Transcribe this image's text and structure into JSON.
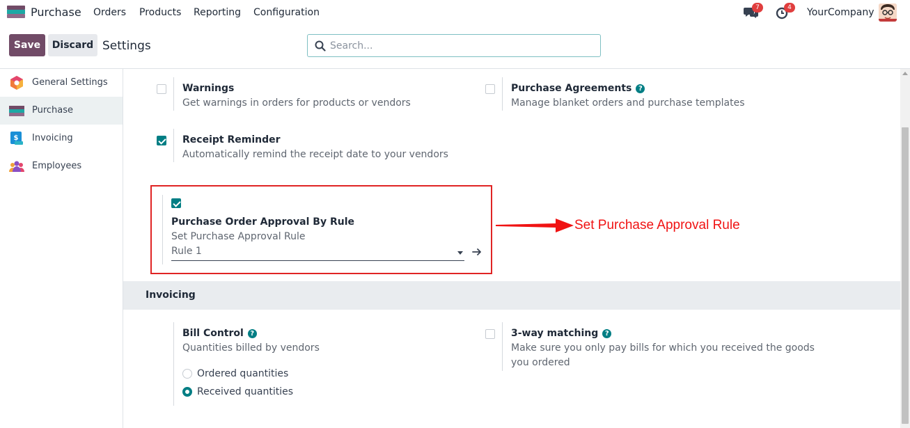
{
  "navbar": {
    "app_name": "Purchase",
    "menu": [
      "Orders",
      "Products",
      "Reporting",
      "Configuration"
    ],
    "messages_count": "7",
    "activities_count": "4",
    "company": "YourCompany"
  },
  "control_panel": {
    "save_label": "Save",
    "discard_label": "Discard",
    "breadcrumb": "Settings",
    "search_placeholder": "Search..."
  },
  "sidebar": {
    "items": [
      {
        "label": "General Settings",
        "icon": "general-settings-icon",
        "active": false
      },
      {
        "label": "Purchase",
        "icon": "purchase-app-icon",
        "active": true
      },
      {
        "label": "Invoicing",
        "icon": "invoicing-app-icon",
        "active": false
      },
      {
        "label": "Employees",
        "icon": "employees-app-icon",
        "active": false
      }
    ]
  },
  "settings": {
    "warnings": {
      "title": "Warnings",
      "desc": "Get warnings in orders for products or vendors",
      "checked": false
    },
    "purchase_agreements": {
      "title": "Purchase Agreements",
      "desc": "Manage blanket orders and purchase templates",
      "checked": false,
      "help": "?"
    },
    "receipt_reminder": {
      "title": "Receipt Reminder",
      "desc": "Automatically remind the receipt date to your vendors",
      "checked": true
    },
    "approval_rule": {
      "title": "Purchase Order Approval By Rule",
      "desc": "Set Purchase Approval Rule",
      "checked": true,
      "selected": "Rule 1"
    }
  },
  "annotation": {
    "text": "Set Purchase Approval Rule",
    "color": "#f01313"
  },
  "invoicing": {
    "header": "Invoicing",
    "bill_control": {
      "title": "Bill Control",
      "desc": "Quantities billed by vendors",
      "help": "?",
      "options": [
        "Ordered quantities",
        "Received quantities"
      ],
      "selected": "Received quantities"
    },
    "three_way": {
      "title": "3-way matching",
      "help": "?",
      "desc_line1": "Make sure you only pay bills for which you received the goods",
      "desc_line2": "you ordered",
      "checked": false
    }
  },
  "colors": {
    "brand": "#714B67",
    "accent": "#017e84",
    "annotation": "#f01313"
  }
}
